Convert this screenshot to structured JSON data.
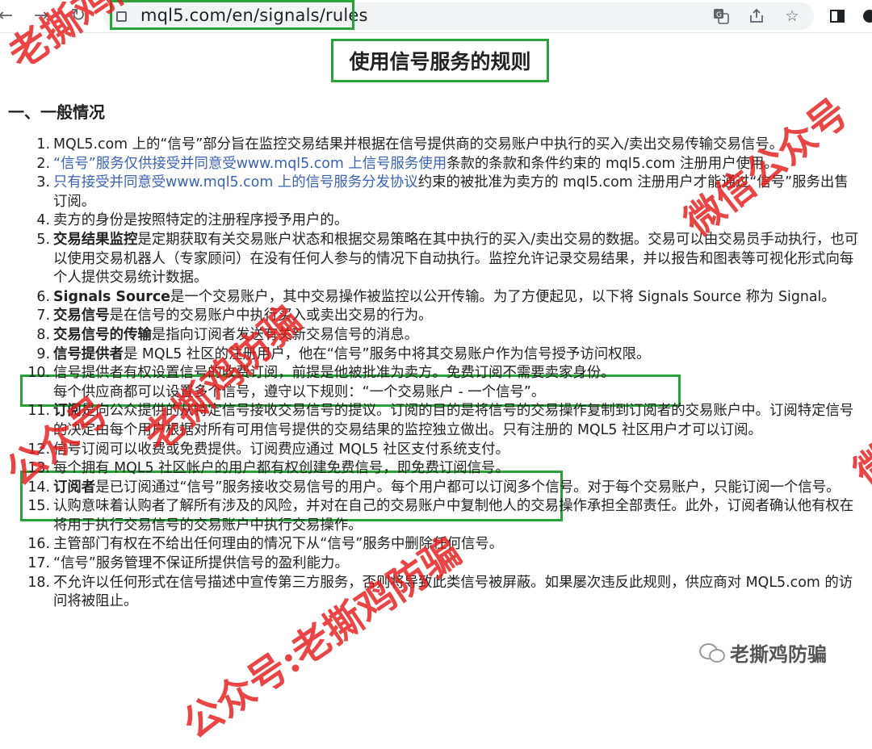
{
  "browser": {
    "url": "mql5.com/en/signals/rules"
  },
  "page": {
    "title": "使用信号服务的规则",
    "section_heading": "一、一般情况",
    "rules": [
      {
        "num": "1.",
        "parts": [
          {
            "t": "MQL5.com 上的“信号”部分旨在监控交易结果并根据在信号提供商的交易账户中执行的买入/卖出交易传输交易信号。"
          }
        ]
      },
      {
        "num": "2.",
        "parts": [
          {
            "t": "“信号”服务仅供接受并同意受www.mql5.com 上信号服务使用",
            "s": "link"
          },
          {
            "t": "条款的条款和条件约束的 mql5.com 注册用户使用。"
          }
        ]
      },
      {
        "num": "3.",
        "parts": [
          {
            "t": "只有接受并同意受www.mql5.com 上的信号服务分发协议",
            "s": "link"
          },
          {
            "t": "约束的被批准为卖方的 mql5.com 注册用户才能通过“信号”服务出售订阅。"
          }
        ]
      },
      {
        "num": "4.",
        "parts": [
          {
            "t": "卖方的身份是按照特定的注册程序授予用户的。"
          }
        ]
      },
      {
        "num": "5.",
        "parts": [
          {
            "t": "交易结果监控",
            "s": "bold"
          },
          {
            "t": "是定期获取有关交易账户状态和根据交易策略在其中执行的买入/卖出交易的数据。交易可以由交易员手动执行，也可以使用交易机器人（专家顾问）在没有任何人参与的情况下自动执行。监控允许记录交易结果，并以报告和图表等可视化形式向每个人提供交易统计数据。"
          }
        ]
      },
      {
        "num": "6.",
        "parts": [
          {
            "t": "Signals Source",
            "s": "bold"
          },
          {
            "t": "是一个交易账户，其中交易操作被监控以公开传输。为了方便起见，以下将 Signals Source 称为 Signal。"
          }
        ]
      },
      {
        "num": "7.",
        "parts": [
          {
            "t": "交易信号",
            "s": "bold"
          },
          {
            "t": "是在信号的交易账户中执行买入或卖出交易的行为。"
          }
        ]
      },
      {
        "num": "8.",
        "parts": [
          {
            "t": "交易信号的传输",
            "s": "bold"
          },
          {
            "t": "是指向订阅者发送有关新交易信号的消息。"
          }
        ]
      },
      {
        "num": "9.",
        "parts": [
          {
            "t": "信号提供者",
            "s": "bold"
          },
          {
            "t": "是 MQL5 社区的注册用户，他在“信号”服务中将其交易账户作为信号授予访问权限。"
          }
        ]
      },
      {
        "num": "10.",
        "parts": [
          {
            "t": "信号提供者有权设置信号的收费订阅，前提是他被批准为卖方。免费订阅不需要卖家身份。"
          }
        ]
      },
      {
        "num": "",
        "parts": [
          {
            "t": "每个供应商都可以设置多个信号，遵守以下规则：“一个交易账户 - 一个信号”。"
          }
        ]
      },
      {
        "num": "11.",
        "parts": [
          {
            "t": "订阅",
            "s": "bold"
          },
          {
            "t": "是向公众提供的从特定信号接收交易信号的提议。订阅的目的是将信号的交易操作复制到订阅者的交易账户中。订阅特定信号的决定由每个用户根据对所有可用信号提供的交易结果的监控独立做出。只有注册的 MQL5 社区用户才可以订阅。"
          }
        ]
      },
      {
        "num": "12.",
        "parts": [
          {
            "t": "信号订阅可以收费或免费提供。订阅费应通过 MQL5 社区支付系统支付。"
          }
        ]
      },
      {
        "num": "13.",
        "parts": [
          {
            "t": "每个拥有 MQL5 社区帐户的用户都有权创建免费信号，即免费订阅信号。"
          }
        ]
      },
      {
        "num": "14.",
        "parts": [
          {
            "t": "订阅者",
            "s": "bold"
          },
          {
            "t": "是已订阅通过“信号”服务接收交易信号的用户。每个用户都可以订阅多个信号。对于每个交易账户，只能订阅一个信号。"
          }
        ]
      },
      {
        "num": "15.",
        "parts": [
          {
            "t": "认购意味着认购者了解所有涉及的风险，并对在自己的交易账户中复制他人的交易操作承担全部责任。此外，订阅者确认他有权在将用于执行交易信号的交易账户中执行交易操作。"
          }
        ]
      },
      {
        "num": "16.",
        "parts": [
          {
            "t": "主管部门有权在不给出任何理由的情况下从“信号”服务中删除任何信号。"
          }
        ]
      },
      {
        "num": "17.",
        "parts": [
          {
            "t": "“信号”服务管理不保证所提供信号的盈利能力。"
          }
        ]
      },
      {
        "num": "18.",
        "parts": [
          {
            "t": "不允许以任何形式在信号描述中宣传第三方服务，否则将导致此类信号被屏蔽。如果屡次违反此规则，供应商对 MQL5.com 的访问将被阻止。"
          }
        ]
      }
    ]
  },
  "watermarks": {
    "top_left": "老撕鸡防骗",
    "right_top": "微信公众号",
    "center": "老撕鸡防骗",
    "left_mid": "公众号",
    "right_mid": "微",
    "bottom": "公众号:老撕鸡防骗"
  },
  "wechat_badge": {
    "text": "老撕鸡防骗"
  },
  "colors": {
    "highlight": "#27a33a",
    "link": "#3a63b3",
    "watermark": "#e41c1c"
  }
}
